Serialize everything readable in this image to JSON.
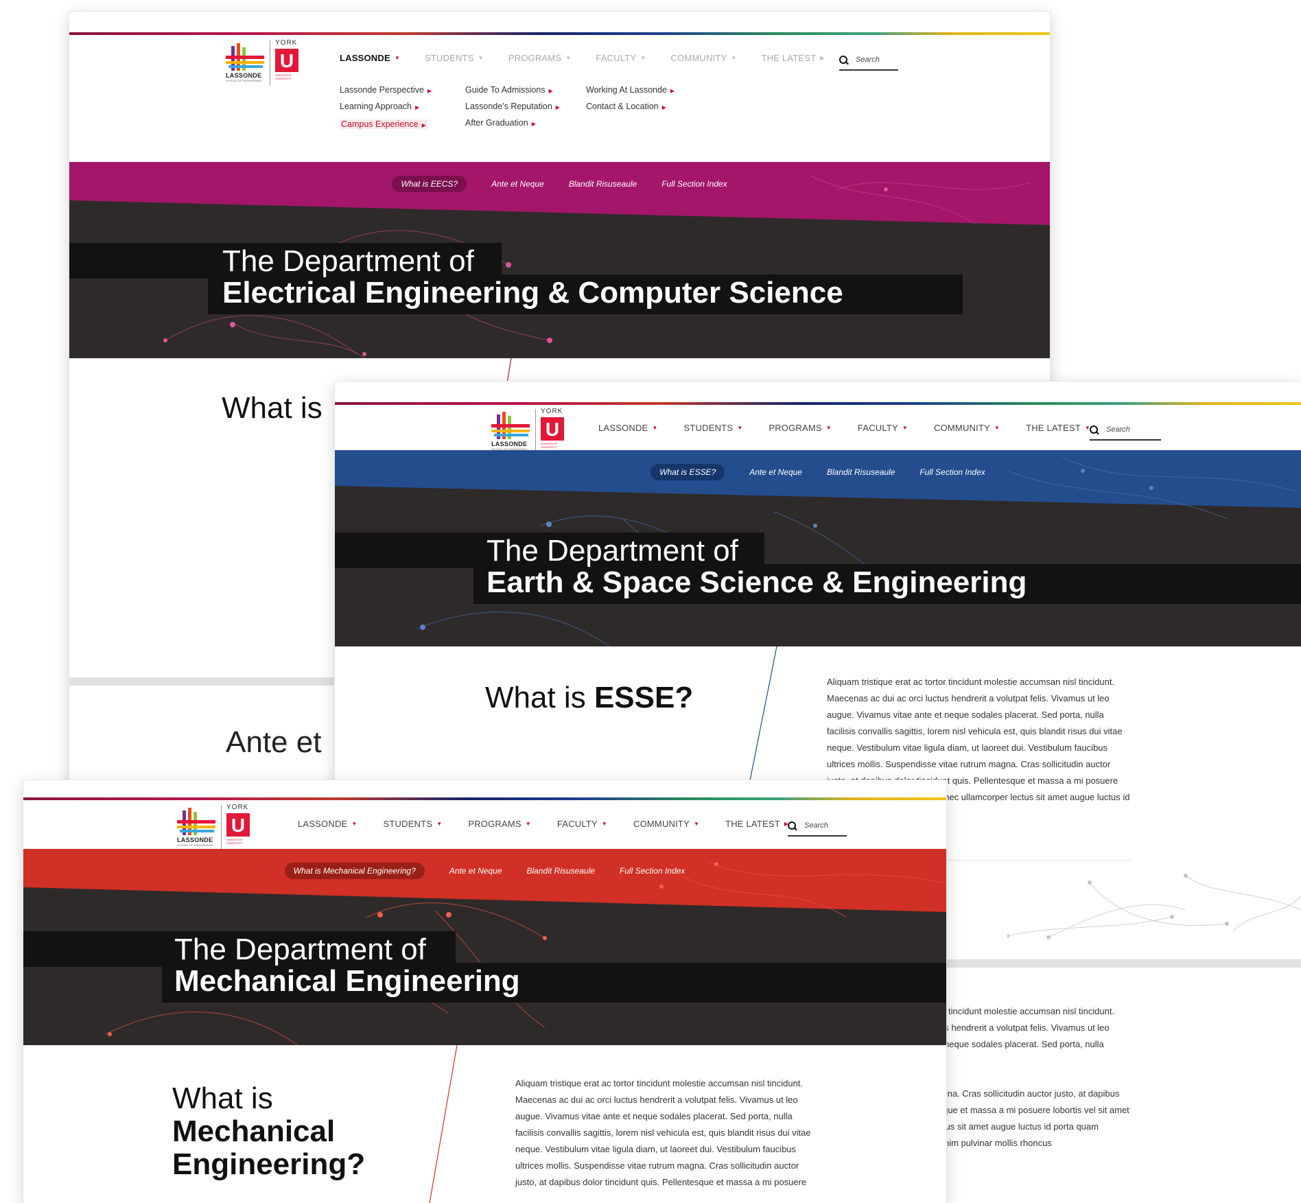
{
  "logo": {
    "lassonde_word": "LASSONDE",
    "lassonde_sub": "SCHOOL OF ENGINEERING",
    "york_word": "YORK",
    "york_letter": "U",
    "york_sub": "UNIVERSITÉ UNIVERSITY"
  },
  "nav": {
    "lassonde": "LASSONDE",
    "students": "STUDENTS",
    "programs": "PROGRAMS",
    "faculty": "FACULTY",
    "community": "COMMUNITY",
    "latest": "THE LATEST"
  },
  "search": {
    "placeholder": "Search"
  },
  "mega_menu": {
    "col1": [
      "Lassonde Perspective",
      "Learning Approach",
      "Campus Experience"
    ],
    "col2": [
      "Guide To Admissions",
      "Lassonde's Reputation",
      "After Graduation"
    ],
    "col3": [
      "Working At Lassonde",
      "Contact & Location"
    ],
    "highlighted": "Campus Experience"
  },
  "colors": {
    "eecs": "#a3166a",
    "esse": "#234d8c",
    "mech": "#d03025",
    "dark": "#2e2a29",
    "band": "#121212",
    "accent_red": "#c8102e"
  },
  "subnav": {
    "link2": "Ante et Neque",
    "link3": "Blandit Risuseaule",
    "link4": "Full Section Index"
  },
  "pages": {
    "eecs": {
      "pill": "What is EECS?",
      "title_top": "The Department of",
      "title_main": "Electrical Engineering & Computer Science",
      "what_prefix": "What is",
      "ante_fragment": "Ante et"
    },
    "esse": {
      "pill": "What is ESSE?",
      "title_top": "The Department of",
      "title_main": "Earth & Space Science & Engineering",
      "what_prefix": "What is",
      "what_bold": "ESSE?",
      "para1": "Aliquam tristique erat ac tortor tincidunt molestie accumsan nisl tincidunt. Maecenas ac dui ac orci luctus hendrerit a volutpat felis. Vivamus ut leo augue. Vivamus vitae ante et neque sodales placerat. Sed porta, nulla facilisis convallis sagittis, lorem nisl vehicula est, quis blandit risus dui vitae neque. Vestibulum vitae ligula diam, ut laoreet dui. Vestibulum faucibus ultrices mollis. Suspendisse vitae rutrum magna. Cras sollicitudin auctor justo, at dapibus dolor tincidunt quis. Pellentesque et massa a mi posuere lobortis vel sit amet lorem. Donec ullamcorper lectus sit amet augue luctus id porta quam lobortis.",
      "para2": "Aliquam tristique erat ac tortor tincidunt molestie accumsan nisl tincidunt. Maecenas ac dui ac orci luctus hendrerit a volutpat felis. Vivamus ut leo augue. Vivamus vitae ante et neque sodales placerat. Sed porta, nulla facilisis convallis sagittis.",
      "para3": "Suspendisse vitae rutrum magna. Cras sollicitudin auctor justo, at dapibus dolor tincidunt quis. Pellentesque et massa a mi posuere lobortis vel sit amet lorem. Donec ullamcorper lectus sit amet augue luctus id porta quam lobortis. Vivamus a dolor eu enim pulvinar mollis rhoncus"
    },
    "mech": {
      "pill": "What is Mechanical Engineering?",
      "title_top": "The Department of",
      "title_main": "Mechanical Engineering",
      "what_prefix": "What is",
      "what_bold1": "Mechanical",
      "what_bold2": "Engineering?",
      "para1": "Aliquam tristique erat ac tortor tincidunt molestie accumsan nisl tincidunt. Maecenas ac dui ac orci luctus hendrerit a volutpat felis. Vivamus ut leo augue. Vivamus vitae ante et neque sodales placerat. Sed porta, nulla facilisis convallis sagittis, lorem nisl vehicula est, quis blandit risus dui vitae neque. Vestibulum vitae ligula diam, ut laoreet dui. Vestibulum faucibus ultrices mollis. Suspendisse vitae rutrum magna. Cras sollicitudin auctor justo, at dapibus dolor tincidunt quis. Pellentesque et massa a mi posuere"
    }
  }
}
